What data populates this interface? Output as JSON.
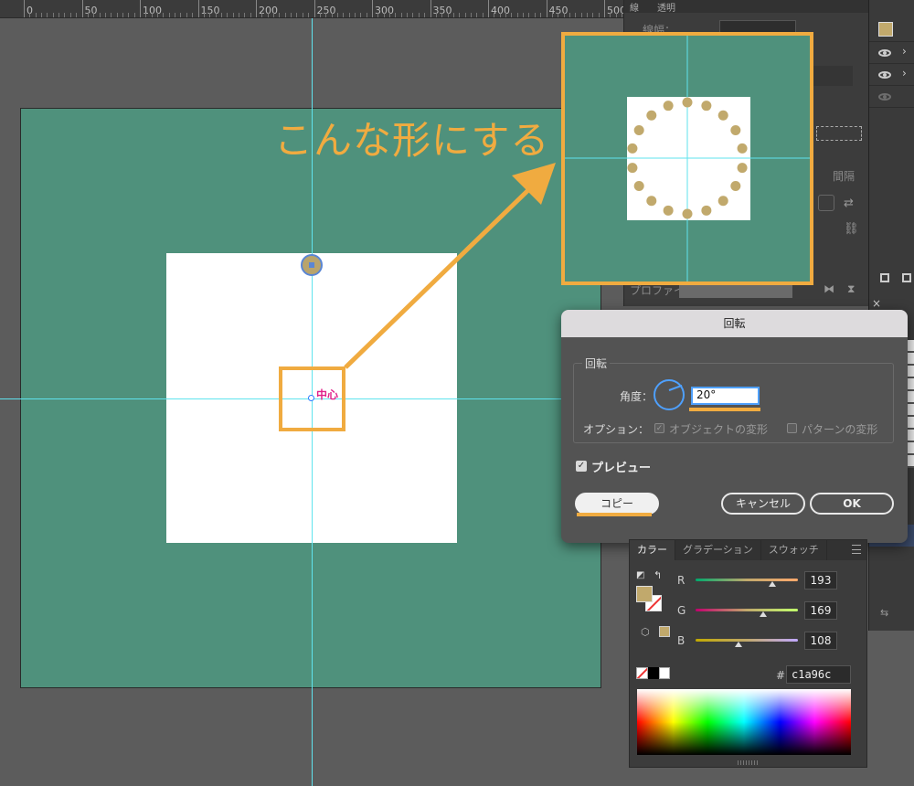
{
  "ruler": {
    "labels": [
      "0",
      "50",
      "100",
      "150",
      "200",
      "250",
      "300",
      "350",
      "400",
      "450",
      "500"
    ]
  },
  "canvas": {
    "caption": "こんな形にする",
    "center_label": "中心",
    "artboard_color": "#4f917c",
    "dot_color": "#c1a96c",
    "highlight_color": "#f0ab40"
  },
  "top_panel": {
    "tab_label": "透明",
    "stroke_label": "線幅：",
    "spacing_label": "間隔",
    "profile_label": "プロファイル："
  },
  "rotate_dialog": {
    "title": "回転",
    "group_label": "回転",
    "angle_label": "角度：",
    "angle_value": "20°",
    "options_label": "オプション：",
    "option_objects": "オブジェクトの変形",
    "option_patterns": "パターンの変形",
    "preview_label": "プレビュー",
    "copy_button": "コピー",
    "cancel_button": "キャンセル",
    "ok_button": "OK"
  },
  "color_panel": {
    "tabs": [
      "カラー",
      "グラデーション",
      "スウォッチ"
    ],
    "channels": [
      {
        "label": "R",
        "value": "193"
      },
      {
        "label": "G",
        "value": "169"
      },
      {
        "label": "B",
        "value": "108"
      }
    ],
    "hex_label": "#",
    "hex_value": "c1a96c"
  }
}
